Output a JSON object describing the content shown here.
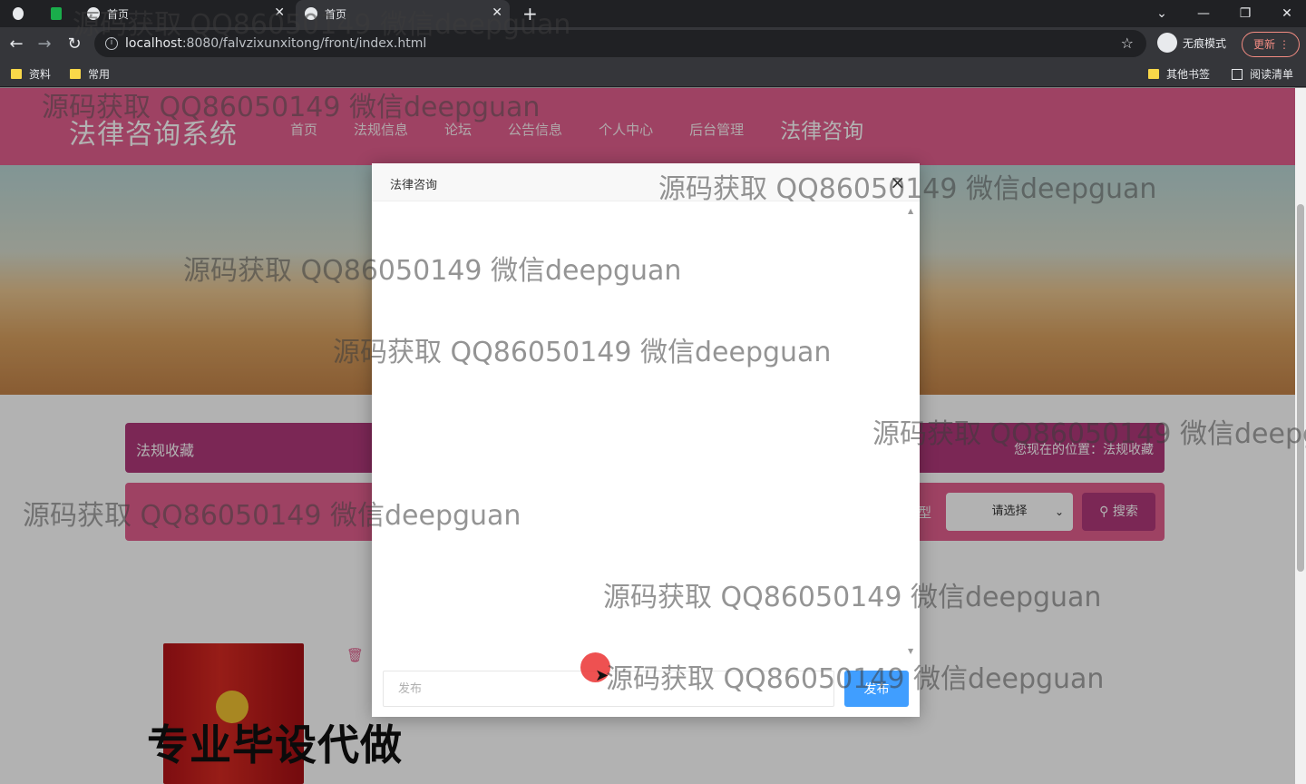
{
  "browser": {
    "tabs": [
      {
        "label": "首页",
        "active": false
      },
      {
        "label": "首页",
        "active": true
      }
    ],
    "new_tab": "+",
    "window_controls": {
      "dropdown": "⌄",
      "minimize": "—",
      "restore": "❐",
      "close": "✕"
    },
    "nav": {
      "back": "←",
      "forward": "→",
      "reload": "↻"
    },
    "url_host": "localhost",
    "url_rest": ":8080/falvzixunxitong/front/index.html",
    "bookmark_star": "☆",
    "incognito_label": "无痕模式",
    "update_label": "更新",
    "update_menu": "⋮",
    "bookmarks": [
      {
        "label": "资料"
      },
      {
        "label": "常用"
      }
    ],
    "other_bookmarks": "其他书签",
    "reading_list": "阅读清单"
  },
  "site": {
    "logo": "法律咨询系统",
    "nav": [
      "首页",
      "法规信息",
      "论坛",
      "公告信息",
      "个人中心",
      "后台管理",
      "法律咨询"
    ],
    "section_title": "法规收藏",
    "location": "您现在的位置：法规收藏",
    "filter_label": "型",
    "select_value": "请选择",
    "search_label": "搜索",
    "promo": "专业毕设代做"
  },
  "modal": {
    "title": "法律咨询",
    "close": "×",
    "input_placeholder": "发布",
    "send_label": "发布"
  },
  "watermark": "源码获取 QQ86050149 微信deepguan",
  "colors": {
    "header_pink": "#e25f8e",
    "panel_purple": "#b0387a",
    "send_blue": "#409eff"
  }
}
